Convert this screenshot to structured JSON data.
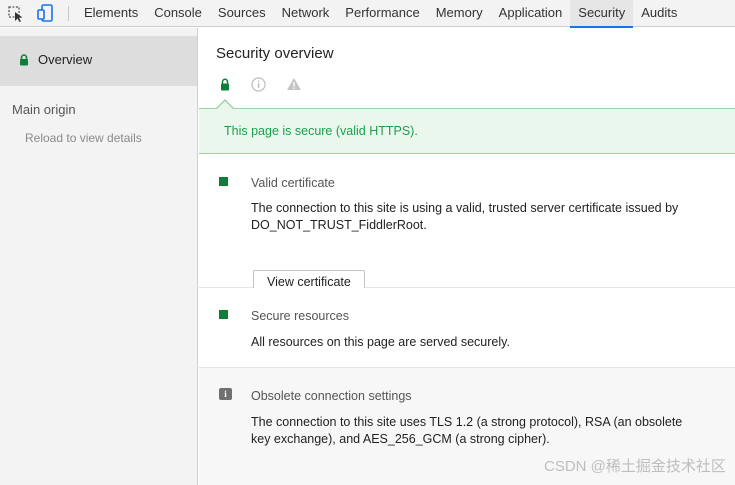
{
  "toolbar": {
    "inspect_icon": "element-picker-icon",
    "device_icon": "device-toolbar-icon",
    "tabs": [
      {
        "label": "Elements"
      },
      {
        "label": "Console"
      },
      {
        "label": "Sources"
      },
      {
        "label": "Network"
      },
      {
        "label": "Performance"
      },
      {
        "label": "Memory"
      },
      {
        "label": "Application"
      },
      {
        "label": "Security",
        "active": true
      },
      {
        "label": "Audits"
      }
    ]
  },
  "sidebar": {
    "overview_label": "Overview",
    "main_origin_label": "Main origin",
    "reload_label": "Reload to view details"
  },
  "main": {
    "title": "Security overview",
    "summary_text": "This page is secure (valid HTTPS).",
    "sections": [
      {
        "icon": "green-square",
        "title": "Valid certificate",
        "description": "The connection to this site is using a valid, trusted server certificate issued by DO_NOT_TRUST_FiddlerRoot.",
        "button_label": "View certificate"
      },
      {
        "icon": "green-square",
        "title": "Secure resources",
        "description": "All resources on this page are served securely."
      },
      {
        "icon": "info-icon",
        "title": "Obsolete connection settings",
        "description": "The connection to this site uses TLS 1.2 (a strong protocol), RSA (an obsolete key exchange), and AES_256_GCM (a strong cipher)."
      }
    ]
  },
  "colors": {
    "secure_green": "#0f7d3a",
    "summary_text_green": "#1e9e4c",
    "summary_bg": "#e9f7ec",
    "active_tab_underline": "#1a73e8"
  },
  "watermark": "CSDN @稀土掘金技术社区"
}
